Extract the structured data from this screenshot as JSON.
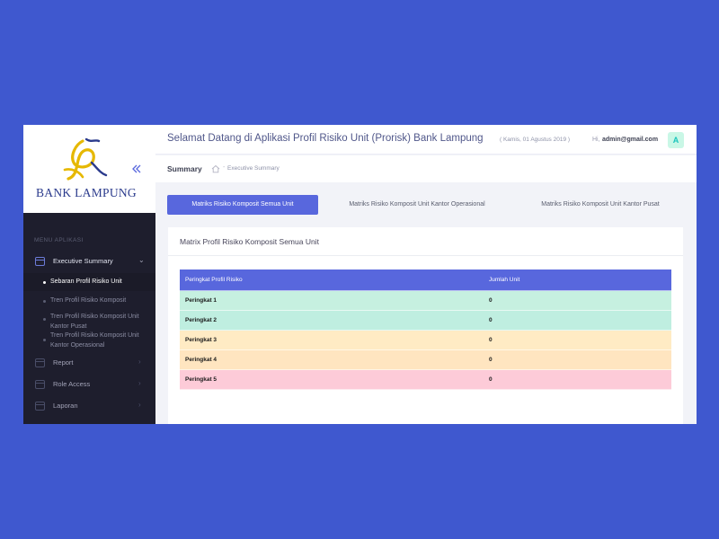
{
  "brand": {
    "name": "BANK LAMPUNG"
  },
  "header": {
    "welcome": "Selamat Datang di Aplikasi Profil Risiko Unit (Prorisk) Bank Lampung",
    "date": "( Kamis, 01 Agustus 2019 )",
    "greeting": "Hi,",
    "user_email": "admin@gmail.com",
    "avatar_initial": "A"
  },
  "subheader": {
    "title": "Summary",
    "separator": "-",
    "breadcrumb": "Executive Summary"
  },
  "sidebar": {
    "section_label": "MENU APLIKASI",
    "items": [
      {
        "label": "Executive Summary",
        "arrow": "⌄"
      },
      {
        "label": "Report",
        "arrow": "›"
      },
      {
        "label": "Role Access",
        "arrow": "›"
      },
      {
        "label": "Laporan",
        "arrow": "›"
      }
    ],
    "sub_items": [
      {
        "label": "Sebaran Profil Risiko Unit"
      },
      {
        "label": "Tren Profil Risiko Komposit"
      },
      {
        "label": "Tren Profil Risiko Komposit Unit Kantor Pusat"
      },
      {
        "label": "Tren Profil Risiko Komposit Unit Kantor Operasional"
      }
    ]
  },
  "tabs": [
    {
      "label": "Matriks Risiko Komposit Semua Unit"
    },
    {
      "label": "Matriks Risiko Komposit Unit Kantor Operasional"
    },
    {
      "label": "Matriks Risiko Komposit Unit Kantor Pusat"
    }
  ],
  "card": {
    "title": "Matrix Profil Risiko Komposit Semua Unit"
  },
  "table": {
    "headers": [
      "Peringkat Profil Risiko",
      "Jumlah Unit"
    ],
    "rows": [
      {
        "rank": "Peringkat 1",
        "count": "0",
        "color": "#c6f0e0"
      },
      {
        "rank": "Peringkat 2",
        "count": "0",
        "color": "#bfeee0"
      },
      {
        "rank": "Peringkat 3",
        "count": "0",
        "color": "#ffebc4"
      },
      {
        "rank": "Peringkat 4",
        "count": "0",
        "color": "#ffe5c0"
      },
      {
        "rank": "Peringkat 5",
        "count": "0",
        "color": "#fdcbd8"
      }
    ]
  },
  "colors": {
    "accent": "#5867dd",
    "background": "#3f58cf",
    "sidebar": "#1e1e2d",
    "logo_gold": "#e6b800"
  }
}
